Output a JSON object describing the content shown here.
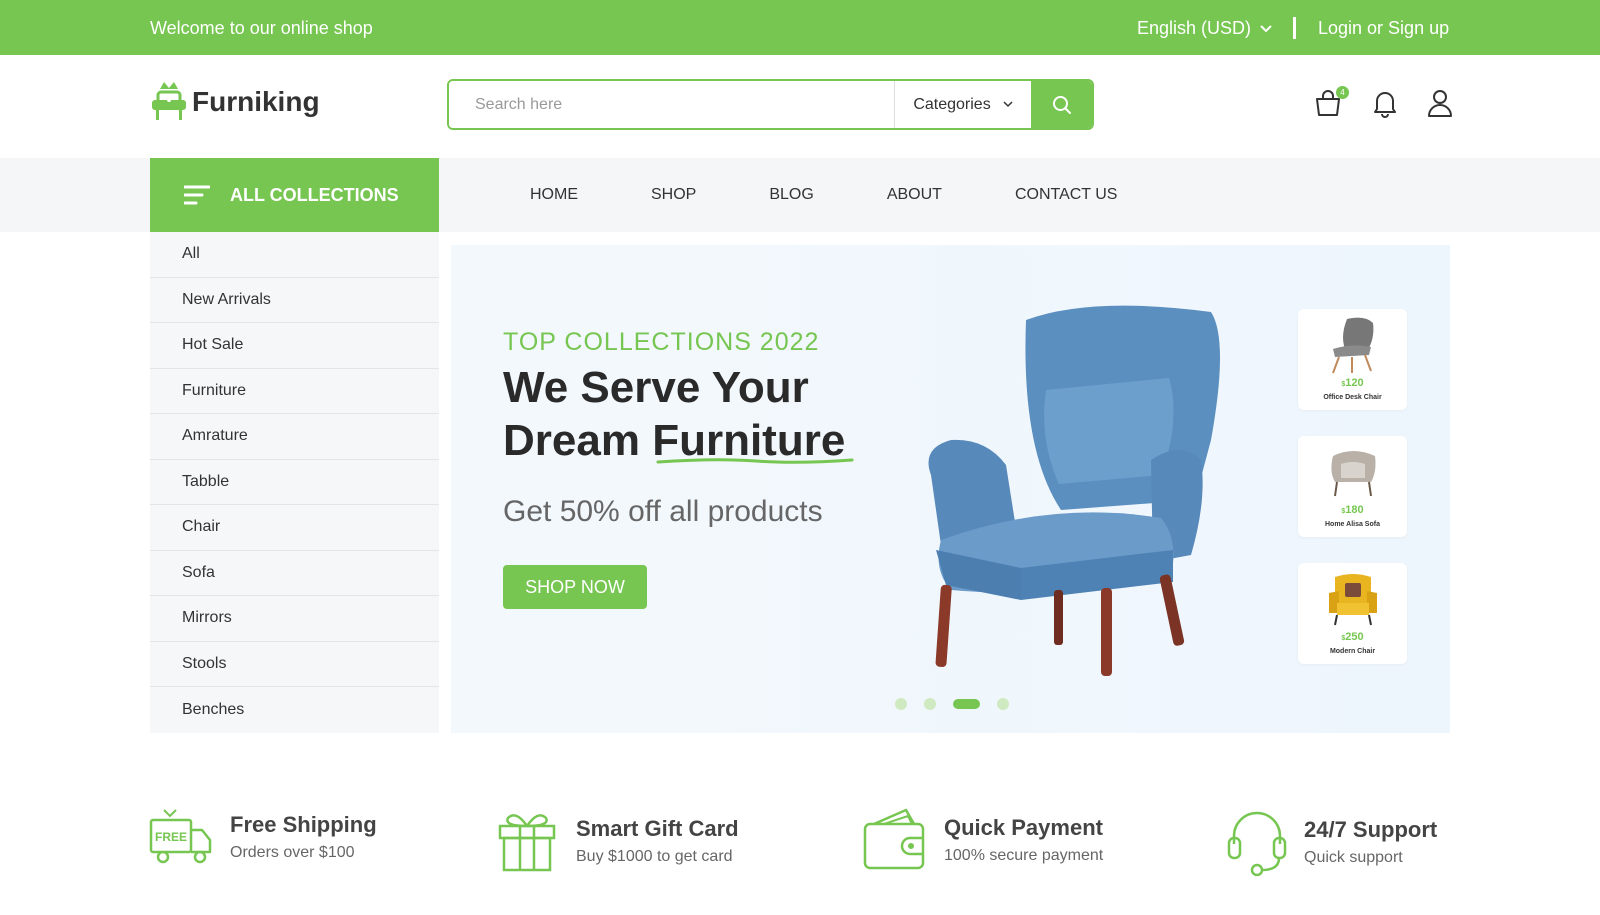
{
  "topbar": {
    "welcome": "Welcome to our online shop",
    "language": "English (USD)",
    "login": "Login or Sign up"
  },
  "header": {
    "logo_text": "Furniking",
    "search_placeholder": "Search here",
    "categories_label": "Categories",
    "cart_count": "4"
  },
  "nav": {
    "all_collections": "ALL COLLECTIONS",
    "items": [
      "HOME",
      "SHOP",
      "BLOG",
      "ABOUT",
      "CONTACT US"
    ]
  },
  "sidebar": {
    "items": [
      "All",
      "New Arrivals",
      "Hot Sale",
      "Furniture",
      "Amrature",
      "Tabble",
      "Chair",
      "Sofa",
      "Mirrors",
      "Stools",
      "Benches"
    ]
  },
  "hero": {
    "eyebrow": "TOP COLLECTIONS 2022",
    "title_line1": "We Serve Your",
    "title_line2a": "Dream ",
    "title_line2b": "Furniture",
    "subtitle": "Get 50% off all products",
    "cta": "SHOP NOW",
    "slide_count": 4,
    "active_slide": 3,
    "products": [
      {
        "currency": "$",
        "price": "120",
        "name": "Office Desk Chair"
      },
      {
        "currency": "$",
        "price": "180",
        "name": "Home Alisa Sofa"
      },
      {
        "currency": "$",
        "price": "250",
        "name": "Modern Chair"
      }
    ]
  },
  "features": [
    {
      "title": "Free Shipping",
      "subtitle": "Orders over $100",
      "icon": "free-shipping-truck-icon",
      "badge": "FREE"
    },
    {
      "title": "Smart Gift Card",
      "subtitle": "Buy $1000 to get card",
      "icon": "gift-icon"
    },
    {
      "title": "Quick Payment",
      "subtitle": "100% secure payment",
      "icon": "wallet-icon"
    },
    {
      "title": "24/7 Support",
      "subtitle": "Quick support",
      "icon": "headset-icon"
    }
  ],
  "colors": {
    "brand": "#76c651",
    "chair": "#5b8fc0"
  }
}
